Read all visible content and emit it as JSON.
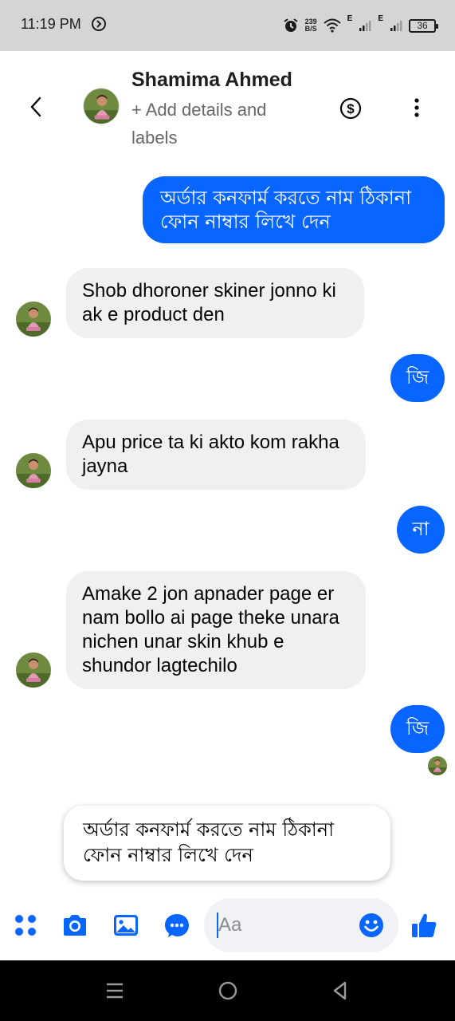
{
  "status_bar": {
    "time": "11:19 PM",
    "net_speed_value": "239",
    "net_speed_unit": "B/S",
    "signal1_label": "E",
    "signal2_label": "E",
    "battery": "36"
  },
  "header": {
    "contact_name": "Shamima Ahmed",
    "add_details": "+ Add details and labels"
  },
  "messages": [
    {
      "direction": "outgoing",
      "text": "অর্ডার কনফার্ম করতে নাম ঠিকানা ফোন নাম্বার লিখে দেন"
    },
    {
      "direction": "incoming",
      "text": "Shob dhoroner skiner jonno ki ak e product den"
    },
    {
      "direction": "outgoing",
      "text": "জি"
    },
    {
      "direction": "incoming",
      "text": "Apu price ta ki akto kom rakha jayna"
    },
    {
      "direction": "outgoing",
      "text": "না"
    },
    {
      "direction": "incoming",
      "text": "Amake 2 jon apnader page er nam bollo ai page theke unara nichen unar skin khub e shundor lagtechilo"
    },
    {
      "direction": "outgoing",
      "text": "জি"
    }
  ],
  "suggestion": {
    "text": "অর্ডার কনফার্ম করতে নাম ঠিকানা ফোন নাম্বার লিখে দেন"
  },
  "composer": {
    "placeholder": "Aa"
  },
  "colors": {
    "accent": "#0866ff",
    "incoming_bubble": "#f0f0f0",
    "status_bar_bg": "#d4d5d7"
  },
  "icons": {
    "back": "chevron-left-icon",
    "payment": "dollar-icon",
    "more": "more-vertical-icon",
    "apps": "apps-icon",
    "camera": "camera-icon",
    "gallery": "image-icon",
    "chat": "chat-bubble-icon",
    "emoji": "emoji-icon",
    "like": "thumbs-up-icon"
  }
}
